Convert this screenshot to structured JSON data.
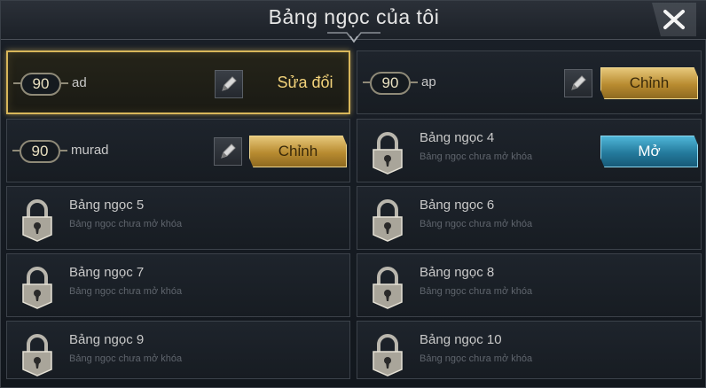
{
  "header": {
    "title": "Bảng ngọc của tôi"
  },
  "slots": [
    {
      "level": "90",
      "name": "ad",
      "action": "Sửa đổi"
    },
    {
      "level": "90",
      "name": "ap",
      "action": "Chỉnh"
    },
    {
      "level": "90",
      "name": "murad",
      "action": "Chỉnh"
    },
    {
      "name": "Bảng ngọc 4",
      "sub": "Bảng ngọc chưa mở khóa",
      "action": "Mở"
    },
    {
      "name": "Bảng ngọc 5",
      "sub": "Bảng ngọc chưa mở khóa"
    },
    {
      "name": "Bảng ngọc 6",
      "sub": "Bảng ngọc chưa mở khóa"
    },
    {
      "name": "Bảng ngọc 7",
      "sub": "Bảng ngọc chưa mở khóa"
    },
    {
      "name": "Bảng ngọc 8",
      "sub": "Bảng ngọc chưa mở khóa"
    },
    {
      "name": "Bảng ngọc 9",
      "sub": "Bảng ngọc chưa mở khóa"
    },
    {
      "name": "Bảng ngọc 10",
      "sub": "Bảng ngọc chưa mở khóa"
    }
  ],
  "icons": {
    "close": "close-icon",
    "edit": "pencil-icon",
    "lock": "padlock-icon"
  },
  "colors": {
    "gold": "#d8b65a",
    "blue": "#247a9c",
    "text": "#c8c8c8",
    "muted": "#5f656d"
  }
}
